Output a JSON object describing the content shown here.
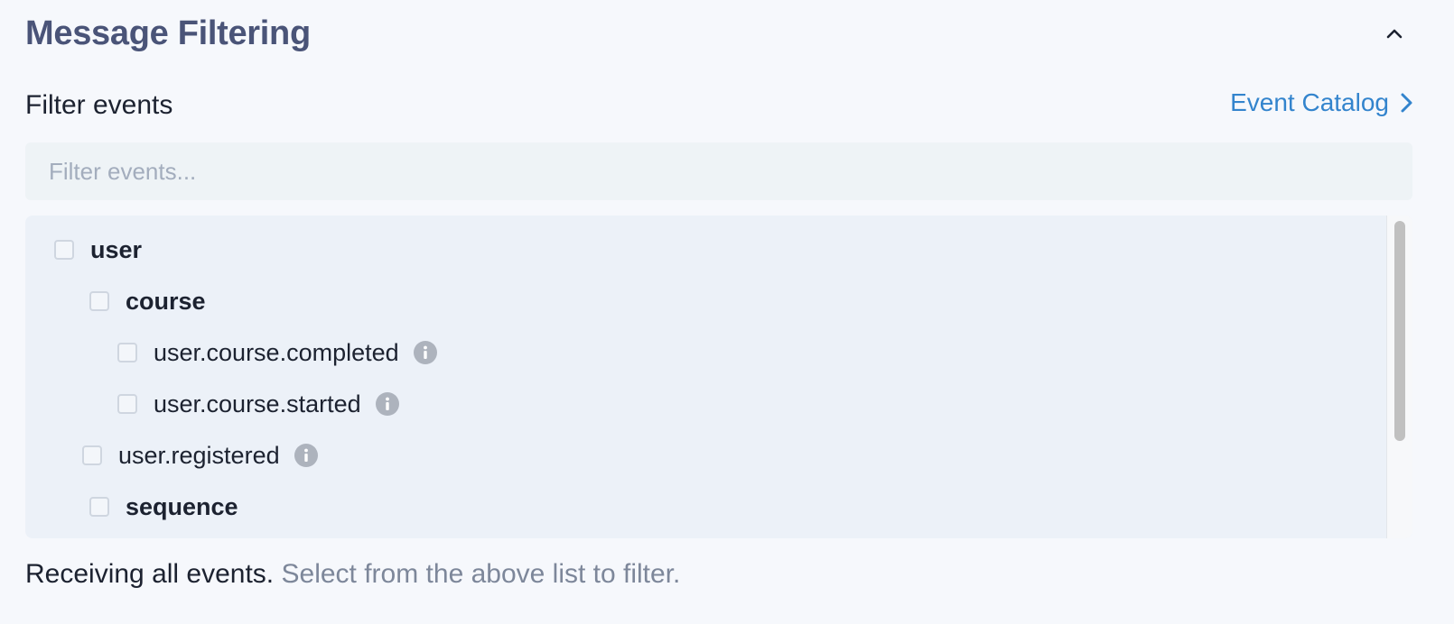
{
  "header": {
    "title": "Message Filtering",
    "collapse_icon": "chevron-up-icon"
  },
  "filter": {
    "label": "Filter events",
    "catalog_link": "Event Catalog",
    "catalog_icon": "chevron-right-icon",
    "search_placeholder": "Filter events...",
    "search_value": ""
  },
  "tree": {
    "items": [
      {
        "label": "user",
        "group": true,
        "checked": false,
        "info": false
      },
      {
        "label": "course",
        "group": true,
        "checked": false,
        "info": false
      },
      {
        "label": "user.course.completed",
        "group": false,
        "checked": false,
        "info": true
      },
      {
        "label": "user.course.started",
        "group": false,
        "checked": false,
        "info": true
      },
      {
        "label": "user.registered",
        "group": false,
        "checked": false,
        "info": true
      },
      {
        "label": "sequence",
        "group": true,
        "checked": false,
        "info": false
      }
    ]
  },
  "footer": {
    "status": "Receiving all events.",
    "hint": "Select from the above list to filter."
  },
  "colors": {
    "title": "#4a5478",
    "link": "#3384cd",
    "panel": "#ecf1f8",
    "search_bg": "#eef3f6"
  }
}
